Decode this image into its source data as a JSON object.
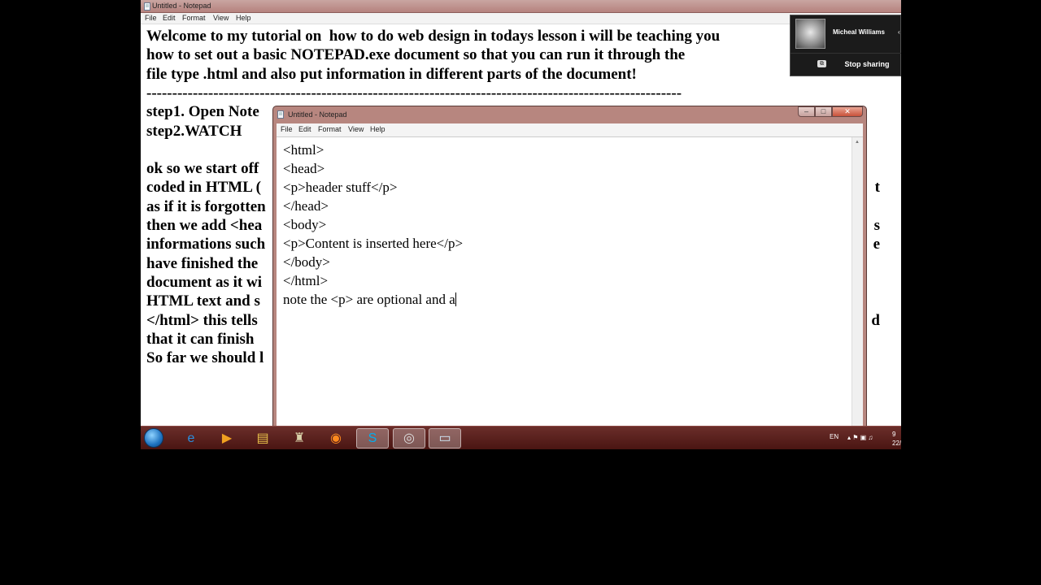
{
  "background_window": {
    "title": "Untitled - Notepad",
    "menu": [
      "File",
      "Edit",
      "Format",
      "View",
      "Help"
    ],
    "lines": [
      "Welcome to my tutorial on  how to do web design in todays lesson i will be teaching you",
      "how to set out a basic NOTEPAD.exe document so that you can run it through the",
      "file type .html and also put information in different parts of the document!",
      "--------------------------------------------------------------------------------------------------------",
      "step1. Open Note",
      "step2.WATCH",
      "",
      "ok so we start off",
      "coded in HTML (",
      "as if it is forgotten",
      "then we add <hea",
      "informations such",
      "have finished the",
      "document as it wi",
      "HTML text and s",
      "</html> this tells",
      "that it can finish",
      "So far we should l"
    ],
    "right_fragments": [
      {
        "line": 8,
        "text": "t"
      },
      {
        "line": 10,
        "text": "s"
      },
      {
        "line": 11,
        "text": "e"
      },
      {
        "line": 15,
        "text": "d"
      }
    ]
  },
  "notepad_window": {
    "title": "Untitled - Notepad",
    "menu": [
      "File",
      "Edit",
      "Format",
      "View",
      "Help"
    ],
    "buttons": {
      "minimize": "–",
      "maximize": "□",
      "close": "✕"
    },
    "content": "<html>\n<head>\n<p>header stuff</p>\n</head>\n<body>\n<p>Content is inserted here</p>\n</body>\n</html>\nnote the <p> are optional and a"
  },
  "screen_share": {
    "caller_name": "Micheal Williams",
    "more_indicator": "‹",
    "share_icon": "⧉",
    "stop_label": "Stop sharing"
  },
  "taskbar": {
    "items": [
      {
        "name": "internet-explorer",
        "glyph": "e",
        "color": "#2a8fe0",
        "active": false
      },
      {
        "name": "media-player",
        "glyph": "▶",
        "color": "#f0a020",
        "active": false
      },
      {
        "name": "file-explorer",
        "glyph": "▤",
        "color": "#e8c14a",
        "active": false
      },
      {
        "name": "game-app",
        "glyph": "♜",
        "color": "#d8d0a8",
        "active": false
      },
      {
        "name": "firefox",
        "glyph": "◉",
        "color": "#ff8a1e",
        "active": false
      },
      {
        "name": "skype",
        "glyph": "S",
        "color": "#00aff0",
        "active": true
      },
      {
        "name": "camera-app",
        "glyph": "◎",
        "color": "#dddddd",
        "active": true
      },
      {
        "name": "notepad",
        "glyph": "▭",
        "color": "#cfe6f5",
        "active": true
      }
    ],
    "language": "EN",
    "tray_icons": "▴ ⚑ ▣ ♫",
    "time": "9",
    "date": "22/"
  }
}
